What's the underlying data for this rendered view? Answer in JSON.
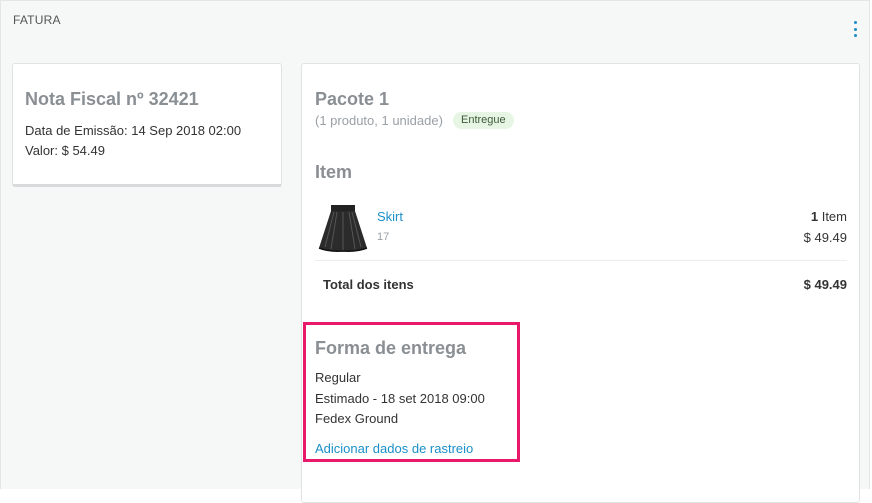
{
  "section": {
    "title": "FATURA"
  },
  "invoice": {
    "title": "Nota Fiscal nº 32421",
    "emission": "Data de Emissão: 14 Sep 2018 02:00",
    "value": "Valor: $ 54.49"
  },
  "package": {
    "title": "Pacote 1",
    "subtitle": "(1 produto, 1 unidade)",
    "status": "Entregue",
    "items_heading": "Item",
    "item": {
      "name": "Skirt",
      "code": "17",
      "qty_number": "1",
      "qty_unit": "Item",
      "price": "$ 49.49",
      "icon": "skirt-icon"
    },
    "total_label": "Total dos itens",
    "total_value": "$ 49.49"
  },
  "shipping": {
    "title": "Forma de entrega",
    "method": "Regular",
    "estimate": "Estimado - 18 set 2018 09:00",
    "carrier": "Fedex Ground",
    "tracking_link": "Adicionar dados de rastreio"
  },
  "colors": {
    "accent": "#1a8fc9",
    "highlight": "#e8186a",
    "badge_bg": "#e7f6e4"
  }
}
